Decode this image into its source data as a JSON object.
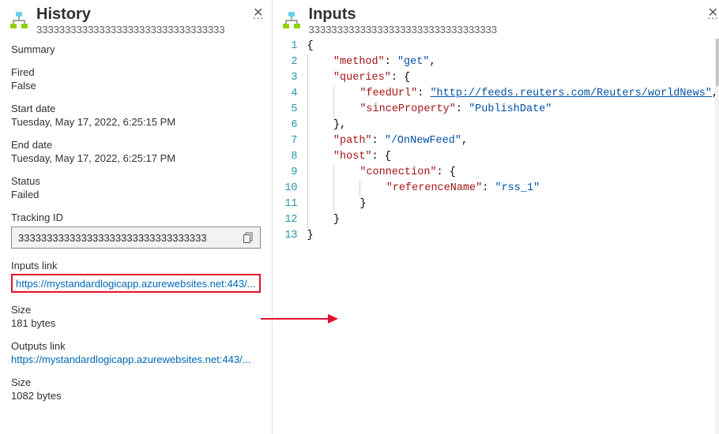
{
  "history": {
    "title": "History",
    "subtitle": "333333333333333333333333333333333",
    "summary_label": "Summary",
    "fired_label": "Fired",
    "fired_value": "False",
    "start_label": "Start date",
    "start_value": "Tuesday, May 17, 2022, 6:25:15 PM",
    "end_label": "End date",
    "end_value": "Tuesday, May 17, 2022, 6:25:17 PM",
    "status_label": "Status",
    "status_value": "Failed",
    "tracking_label": "Tracking ID",
    "tracking_value": "333333333333333333333333333333333",
    "inputs_link_label": "Inputs link",
    "inputs_link_value": "https://mystandardlogicapp.azurewebsites.net:443/...",
    "inputs_size_label": "Size",
    "inputs_size_value": "181 bytes",
    "outputs_link_label": "Outputs link",
    "outputs_link_value": "https://mystandardlogicapp.azurewebsites.net:443/...",
    "outputs_size_label": "Size",
    "outputs_size_value": "1082 bytes"
  },
  "inputs": {
    "title": "Inputs",
    "subtitle": "333333333333333333333333333333333",
    "json": {
      "method": "get",
      "queries": {
        "feedUrl": "http://feeds.reuters.com/Reuters/worldNews",
        "sinceProperty": "PublishDate"
      },
      "path": "/OnNewFeed",
      "host": {
        "connection": {
          "referenceName": "rss_1"
        }
      }
    },
    "lines": [
      "{",
      "    \"method\": \"get\",",
      "    \"queries\": {",
      "        \"feedUrl\": \"http://feeds.reuters.com/Reuters/worldNews\",",
      "        \"sinceProperty\": \"PublishDate\"",
      "    },",
      "    \"path\": \"/OnNewFeed\",",
      "    \"host\": {",
      "        \"connection\": {",
      "            \"referenceName\": \"rss_1\"",
      "        }",
      "    }",
      "}"
    ]
  }
}
